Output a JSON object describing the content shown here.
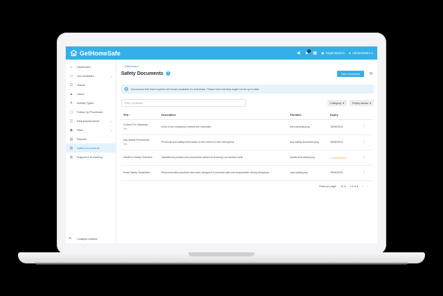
{
  "app": {
    "name": "GetHomeSafe",
    "brand_color": "#34b0e8"
  },
  "topbar": {
    "notification_count": "1",
    "organisations_label": "Organisations",
    "user_label": "Administrator 1"
  },
  "sidebar": {
    "items": [
      {
        "label": "Dashboard",
        "icon": "home-icon",
        "chevron": false
      },
      {
        "label": "Your Activities",
        "icon": "calendar-icon",
        "chevron": true
      },
      {
        "label": "Teams",
        "icon": "team-icon",
        "chevron": false
      },
      {
        "label": "Users",
        "icon": "user-icon",
        "chevron": false
      },
      {
        "label": "Activity Types",
        "icon": "activity-icon",
        "chevron": false
      },
      {
        "label": "Follow Up Processes",
        "icon": "process-icon",
        "chevron": false
      },
      {
        "label": "Risk Assessments",
        "icon": "risk-icon",
        "chevron": true
      },
      {
        "label": "Sites",
        "icon": "location-icon",
        "chevron": true
      },
      {
        "label": "Reports",
        "icon": "report-icon",
        "chevron": false
      },
      {
        "label": "Safety Documents",
        "icon": "document-icon",
        "chevron": false,
        "active": true
      },
      {
        "label": "Support & eLearning",
        "icon": "support-icon",
        "chevron": false
      }
    ],
    "collapse_label": "Collapse sidebar"
  },
  "main": {
    "back_label": "Dashboard",
    "page_title": "Safety Documents",
    "new_button_label": "New document",
    "alert_text": "Documents that have expired will remain available for download. Please note that they might not be up to date.",
    "filter_placeholder": "Filter (optional)",
    "category_label": "Category",
    "expiry_label": "Expiry status",
    "columns": {
      "title": "Title",
      "description": "Description",
      "filename": "Filename",
      "expiry": "Expiry"
    },
    "rows": [
      {
        "title": "Current Fire Marshals",
        "tag": "Fire",
        "description": "A list of our company's current fire marshals",
        "filename": "fire-marshals.png",
        "expiry": "18/06/2024",
        "warning": false
      },
      {
        "title": "Key Safety Procedures",
        "tag": "Fire",
        "description": "Protocols and safety information in the event of a fire emergency",
        "filename": "key-safety-document.png",
        "expiry": "18/06/2024",
        "warning": false
      },
      {
        "title": "Health & Safety Overview",
        "tag": "",
        "description": "Operational policies and procedures aimed at ensuring our workers safe",
        "filename": "health-and-safety.png",
        "expiry": "09/05/2024",
        "warning": true
      },
      {
        "title": "Road Safety Guidelines",
        "tag": "",
        "description": "Recommended practices and rules designed to promote safe and responsible driving behaviour",
        "filename": "road-safety.png",
        "expiry": "18/06/2025",
        "warning": false
      }
    ],
    "pagination": {
      "rows_per_page_label": "Rows per page:",
      "rows_per_page_value": "10",
      "range_label": "1-4 of 4"
    }
  }
}
